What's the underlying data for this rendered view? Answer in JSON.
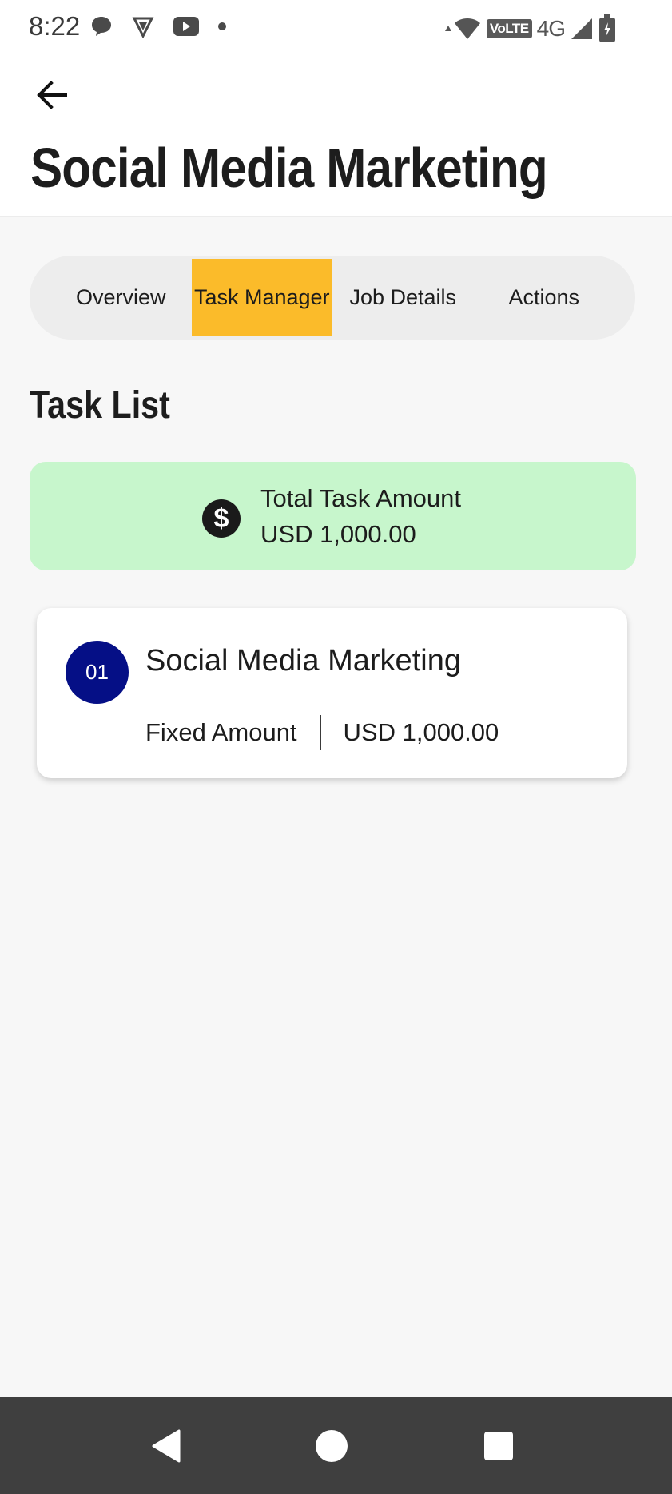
{
  "status_bar": {
    "time": "8:22",
    "network": "4G",
    "volte": "VoLTE",
    "left_icons": [
      "chat-bubble-icon",
      "shield-v-icon",
      "youtube-icon",
      "dot-icon"
    ],
    "right_icons": [
      "wifi-icon",
      "signal-icon",
      "battery-icon"
    ]
  },
  "header": {
    "back_icon": "arrow-left-icon",
    "title": "Social Media Marketing"
  },
  "tabs": [
    {
      "label": "Overview",
      "active": false
    },
    {
      "label": "Task Manager",
      "active": true
    },
    {
      "label": "Job Details",
      "active": false
    },
    {
      "label": "Actions",
      "active": false
    }
  ],
  "task_list": {
    "heading": "Task List",
    "total": {
      "icon": "dollar-circle-icon",
      "label": "Total Task Amount",
      "value": "USD 1,000.00"
    },
    "items": [
      {
        "number": "01",
        "title": "Social Media Marketing",
        "type": "Fixed Amount",
        "amount": "USD 1,000.00"
      }
    ]
  },
  "nav_bar": {
    "buttons": [
      "back-triangle-icon",
      "home-circle-icon",
      "recents-square-icon"
    ]
  },
  "colors": {
    "accent_tab": "#fbbb2a",
    "total_bg": "#c7f6cc",
    "task_badge": "#050f86",
    "nav_bar": "#3f3f3f"
  }
}
